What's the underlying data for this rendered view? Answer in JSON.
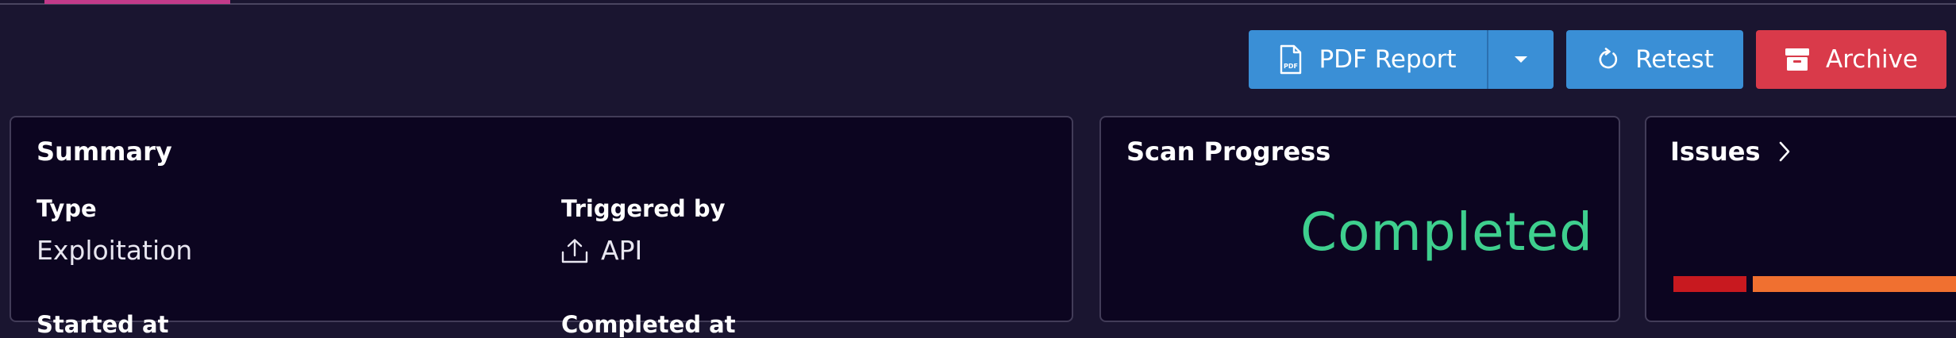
{
  "toolbar": {
    "pdf_label": "PDF Report",
    "retest_label": "Retest",
    "archive_label": "Archive"
  },
  "summary": {
    "title": "Summary",
    "type_label": "Type",
    "type_value": "Exploitation",
    "triggered_label": "Triggered by",
    "triggered_value": "API",
    "started_label": "Started at",
    "completed_label": "Completed at"
  },
  "progress": {
    "title": "Scan Progress",
    "status": "Completed"
  },
  "issues": {
    "title": "Issues",
    "bar_colors": [
      "#c8191f",
      "#f07030"
    ]
  },
  "colors": {
    "accent_blue": "#3a8fd6",
    "archive_red": "#d93a4a",
    "completed_green": "#3ecf8e",
    "tab_active": "#c23a8a"
  },
  "icons": {
    "pdf": "pdf-file-icon",
    "caret": "chevron-down-icon",
    "retest": "refresh-icon",
    "archive": "archive-box-icon",
    "upload": "upload-icon",
    "issues": "chevron-right-icon"
  }
}
